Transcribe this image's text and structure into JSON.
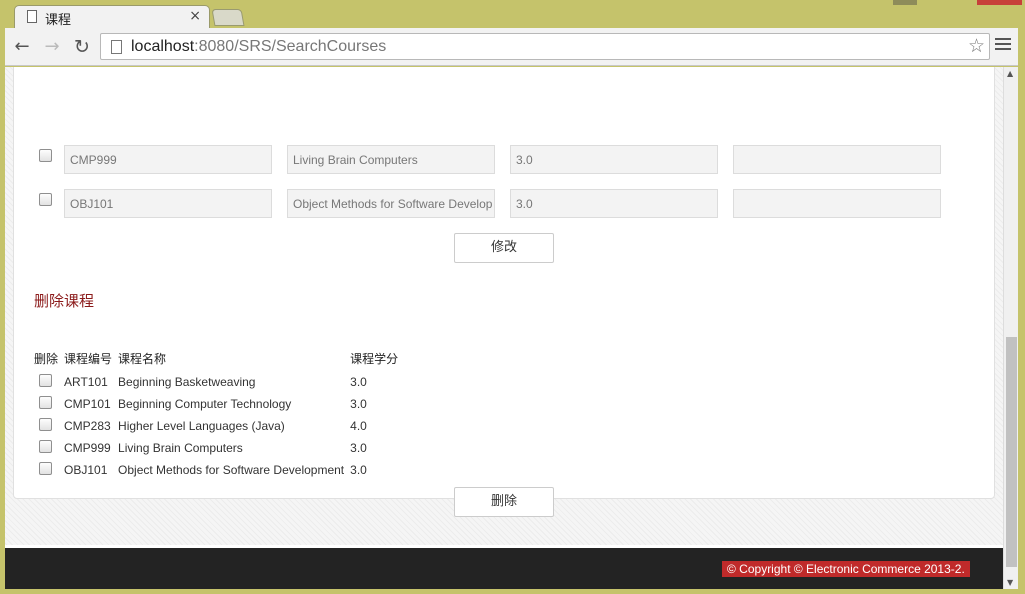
{
  "browser": {
    "tab_title": "课程",
    "tab_close": "×",
    "url_host": "localhost",
    "url_rest": ":8080/SRS/SearchCourses"
  },
  "edit_rows": [
    {
      "code": "CMP999",
      "name": "Living Brain Computers",
      "credits": "3.0",
      "extra": ""
    },
    {
      "code": "OBJ101",
      "name": "Object Methods for Software Develop",
      "credits": "3.0",
      "extra": ""
    }
  ],
  "update_button": "修改",
  "delete_section": {
    "title": "删除课程",
    "headers": {
      "select": "删除",
      "code": "课程编号",
      "name": "课程名称",
      "credits": "课程学分"
    },
    "rows": [
      {
        "code": "ART101",
        "name": "Beginning Basketweaving",
        "credits": "3.0"
      },
      {
        "code": "CMP101",
        "name": "Beginning Computer Technology",
        "credits": "3.0"
      },
      {
        "code": "CMP283",
        "name": "Higher Level Languages (Java)",
        "credits": "4.0"
      },
      {
        "code": "CMP999",
        "name": "Living Brain Computers",
        "credits": "3.0"
      },
      {
        "code": "OBJ101",
        "name": "Object Methods for Software Development",
        "credits": "3.0"
      }
    ],
    "button": "删除"
  },
  "footer": {
    "copyright": "© Copyright © Electronic Commerce 2013-2."
  },
  "colors": {
    "accent_red": "#c02a2a",
    "section_title": "#8b1a1a",
    "chrome_frame": "#c5c36b"
  }
}
